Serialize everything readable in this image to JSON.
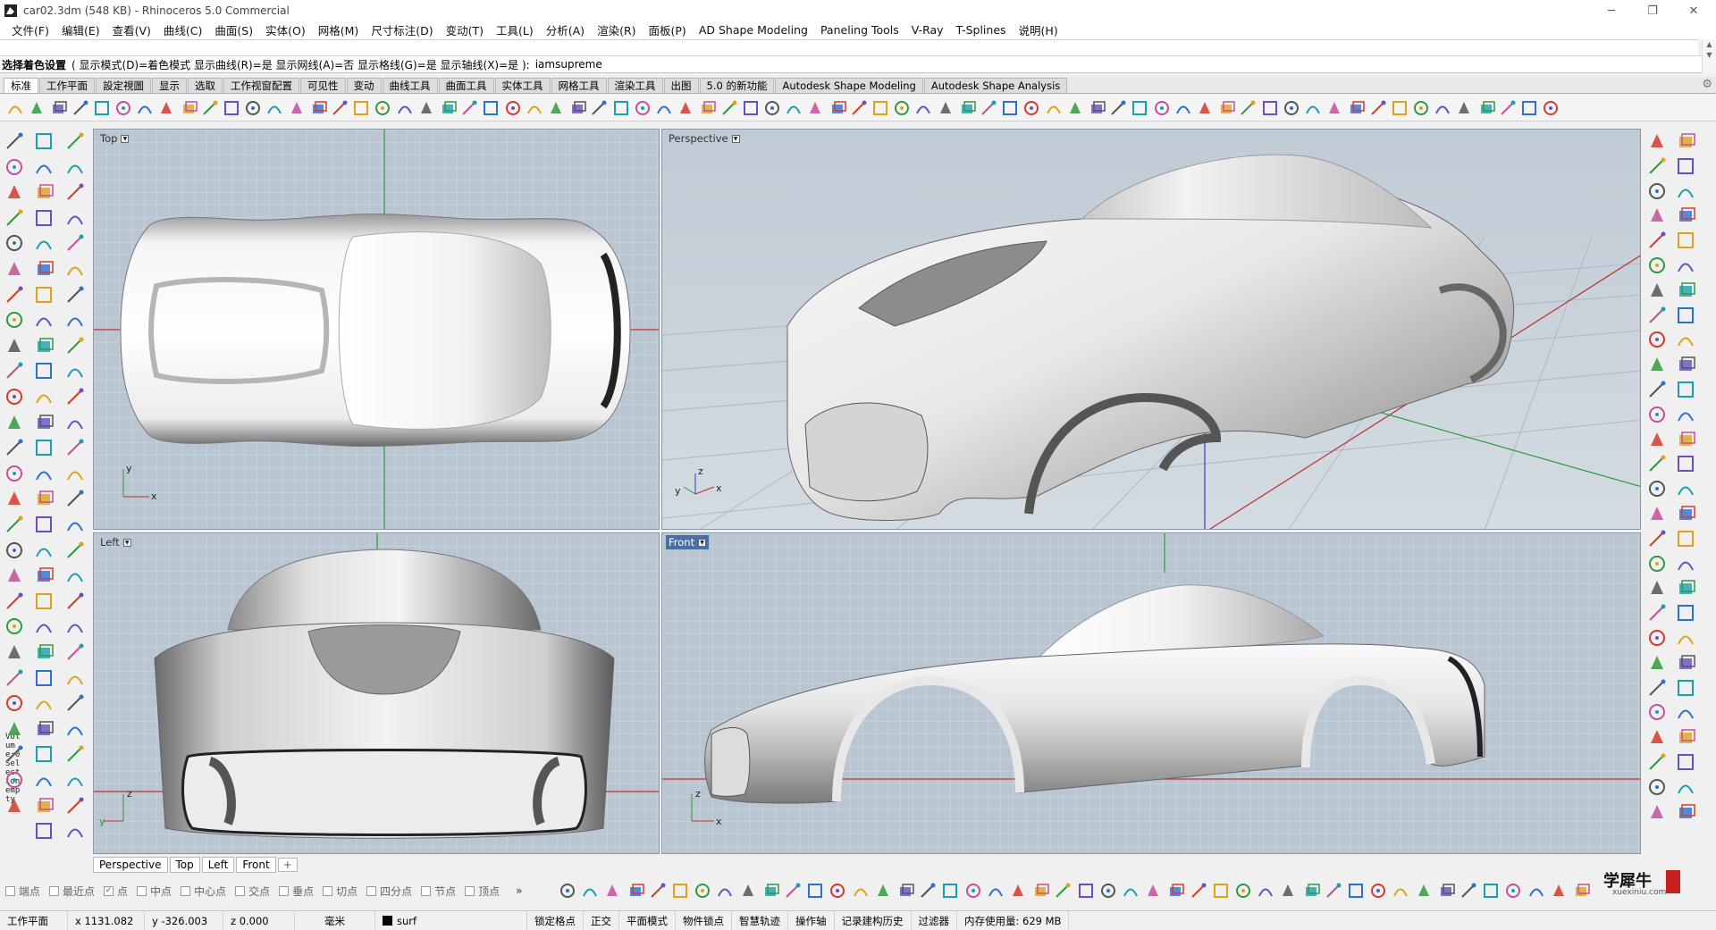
{
  "window": {
    "title": "car02.3dm (548 KB) - Rhinoceros 5.0 Commercial",
    "minimize_icon": "minimize-icon",
    "restore_icon": "restore-icon",
    "close_icon": "close-icon"
  },
  "menu": [
    "文件(F)",
    "编辑(E)",
    "查看(V)",
    "曲线(C)",
    "曲面(S)",
    "实体(O)",
    "网格(M)",
    "尺寸标注(D)",
    "变动(T)",
    "工具(L)",
    "分析(A)",
    "渲染(R)",
    "面板(P)",
    "AD Shape Modeling",
    "Paneling Tools",
    "V-Ray",
    "T-Splines",
    "说明(H)"
  ],
  "command": {
    "prompt": "选择着色设置",
    "options": "( 显示模式(D)=着色模式  显示曲线(R)=是  显示网线(A)=否  显示格线(G)=是  显示轴线(X)=是 ):",
    "typed": "iamsupreme"
  },
  "toolbar_tabs": [
    "标准",
    "工作平面",
    "設定視圖",
    "显示",
    "选取",
    "工作视窗配置",
    "可见性",
    "变动",
    "曲线工具",
    "曲面工具",
    "实体工具",
    "网格工具",
    "渲染工具",
    "出图",
    "5.0 的新功能",
    "Autodesk Shape Modeling",
    "Autodesk Shape Analysis"
  ],
  "active_tab": 0,
  "viewports": {
    "top": {
      "name": "Top",
      "axis_h": "x",
      "axis_v": "y"
    },
    "perspective": {
      "name": "Perspective",
      "axis_h": "x",
      "axis_v": "z",
      "axis_d": "y"
    },
    "left": {
      "name": "Left",
      "axis_h": "y",
      "axis_v": "z"
    },
    "front": {
      "name": "Front",
      "axis_h": "x",
      "axis_v": "z"
    }
  },
  "viewport_tabs": [
    "Perspective",
    "Top",
    "Left",
    "Front"
  ],
  "viewport_tab_add": "+",
  "tool_info_text": "Volume:0Selectionempty",
  "osnaps": [
    {
      "label": "端点",
      "checked": false
    },
    {
      "label": "最近点",
      "checked": false
    },
    {
      "label": "点",
      "checked": true
    },
    {
      "label": "中点",
      "checked": false
    },
    {
      "label": "中心点",
      "checked": false
    },
    {
      "label": "交点",
      "checked": false
    },
    {
      "label": "垂点",
      "checked": false
    },
    {
      "label": "切点",
      "checked": false
    },
    {
      "label": "四分点",
      "checked": false
    },
    {
      "label": "节点",
      "checked": false
    },
    {
      "label": "顶点",
      "checked": false
    }
  ],
  "osnap_more": "»",
  "status": {
    "cplane": "工作平面",
    "x": "x 1131.082",
    "y": "y -326.003",
    "z": "z 0.000",
    "units": "毫米",
    "layer": "surf",
    "layer_color": "#000000",
    "grid_snap": "锁定格点",
    "ortho": "正交",
    "planar": "平面模式",
    "osnap": "物件锁点",
    "smarttrack": "智慧轨迹",
    "gumball": "操作轴",
    "history": "记录建构历史",
    "filter": "过滤器",
    "memory": "内存使用量: 629 MB"
  },
  "watermark": {
    "text": "学犀牛",
    "url": "xuexiniu.com"
  },
  "colors": {
    "viewport_bg": "#b9c5d0",
    "active_viewport_label": "#4a6fa5",
    "axis_x": "#c03030",
    "axis_y": "#2f9a3c",
    "axis_z": "#3040c0"
  }
}
